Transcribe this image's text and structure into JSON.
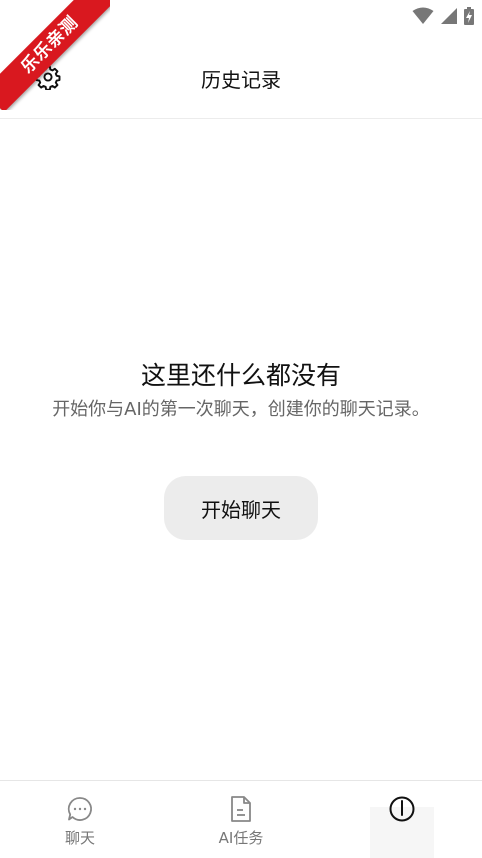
{
  "watermark": {
    "text": "乐乐亲测"
  },
  "status_bar": {
    "icons": [
      "wifi-icon",
      "signal-icon",
      "battery-charging-icon"
    ]
  },
  "header": {
    "title": "历史记录",
    "settings_icon": "gear-icon"
  },
  "empty_state": {
    "title": "这里还什么都没有",
    "description": "开始你与AI的第一次聊天，创建你的聊天记录。",
    "button_label": "开始聊天"
  },
  "bottom_nav": {
    "items": [
      {
        "label": "聊天",
        "icon": "chat-bubble-icon"
      },
      {
        "label": "AI任务",
        "icon": "document-icon"
      },
      {
        "label": "",
        "icon": "history-icon",
        "active": true
      }
    ]
  },
  "colors": {
    "watermark": "#d9181f",
    "button_bg": "#ececec",
    "text_secondary": "#666666"
  }
}
